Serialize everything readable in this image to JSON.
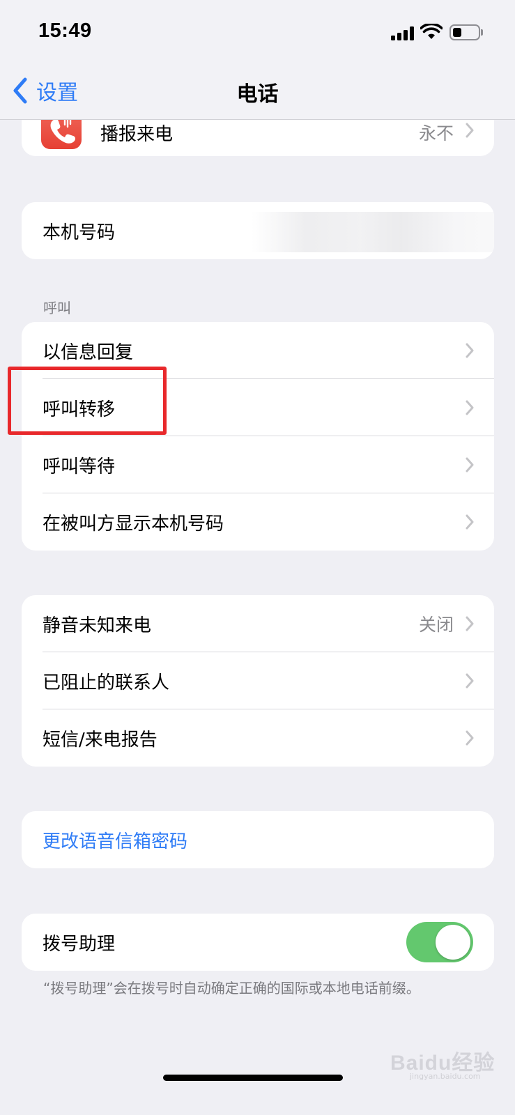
{
  "status_bar": {
    "time": "15:49",
    "battery_level": 0.35
  },
  "nav": {
    "back_label": "设置",
    "title": "电话"
  },
  "announce_calls": {
    "label": "播报来电",
    "value": "永不"
  },
  "my_number": {
    "label": "本机号码"
  },
  "calls_section": {
    "header": "呼叫",
    "items": [
      {
        "label": "以信息回复"
      },
      {
        "label": "呼叫转移"
      },
      {
        "label": "呼叫等待"
      },
      {
        "label": "在被叫方显示本机号码"
      }
    ]
  },
  "privacy_section": {
    "items": [
      {
        "label": "静音未知来电",
        "value": "关闭"
      },
      {
        "label": "已阻止的联系人"
      },
      {
        "label": "短信/来电报告"
      }
    ]
  },
  "voicemail": {
    "label": "更改语音信箱密码"
  },
  "dial_assist": {
    "label": "拨号助理",
    "enabled": true,
    "note": "“拨号助理”会在拨号时自动确定正确的国际或本地电话前缀。"
  },
  "watermark": {
    "text": "Baidu经验",
    "sub": "jingyan.baidu.com"
  },
  "colors": {
    "accent": "#2f7cf6",
    "toggle_on": "#63c86e",
    "highlight_box": "#e8282b",
    "background": "#efeff4"
  }
}
